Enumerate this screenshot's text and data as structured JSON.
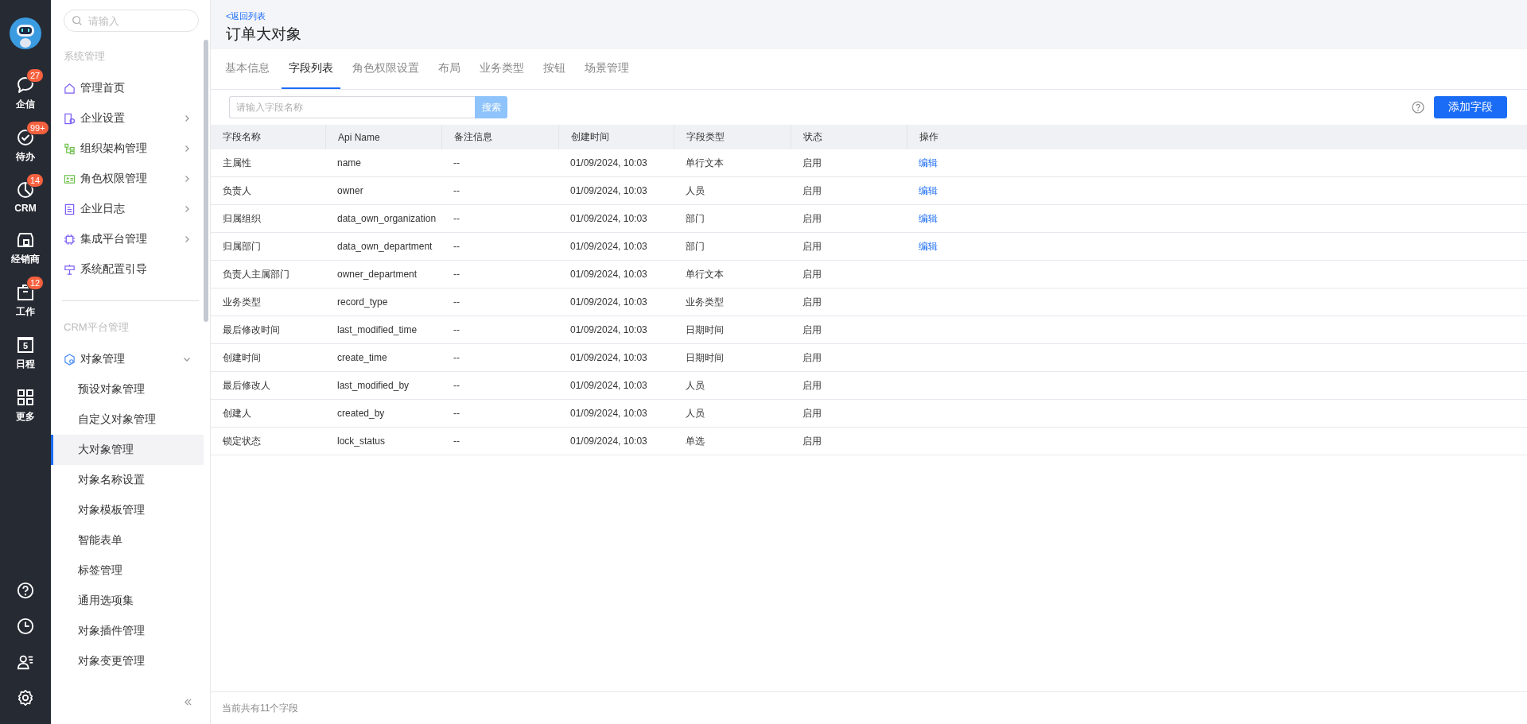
{
  "rail": {
    "items": [
      {
        "label": "企信",
        "badge": "27"
      },
      {
        "label": "待办",
        "badge": "99+"
      },
      {
        "label": "CRM",
        "badge": "14"
      },
      {
        "label": "经销商"
      },
      {
        "label": "工作",
        "badge": "12"
      },
      {
        "label": "日程",
        "day": "5"
      },
      {
        "label": "更多"
      }
    ]
  },
  "sidebar": {
    "search": {
      "placeholder": "请输入"
    },
    "sections": [
      {
        "title": "系统管理",
        "items": [
          {
            "label": "管理首页",
            "kind": "link"
          },
          {
            "label": "企业设置",
            "kind": "group",
            "expanded": false
          },
          {
            "label": "组织架构管理",
            "kind": "group",
            "expanded": false
          },
          {
            "label": "角色权限管理",
            "kind": "group",
            "expanded": false
          },
          {
            "label": "企业日志",
            "kind": "group",
            "expanded": false
          },
          {
            "label": "集成平台管理",
            "kind": "group",
            "expanded": false
          },
          {
            "label": "系统配置引导",
            "kind": "link"
          }
        ]
      },
      {
        "title": "CRM平台管理",
        "items": [
          {
            "label": "对象管理",
            "kind": "group",
            "expanded": true,
            "children": [
              {
                "label": "预设对象管理",
                "selected": false
              },
              {
                "label": "自定义对象管理",
                "selected": false
              },
              {
                "label": "大对象管理",
                "selected": true
              },
              {
                "label": "对象名称设置",
                "selected": false
              },
              {
                "label": "对象模板管理",
                "selected": false
              },
              {
                "label": "智能表单",
                "selected": false
              },
              {
                "label": "标签管理",
                "selected": false
              },
              {
                "label": "通用选项集",
                "selected": false
              },
              {
                "label": "对象插件管理",
                "selected": false
              },
              {
                "label": "对象变更管理",
                "selected": false
              }
            ]
          }
        ]
      }
    ]
  },
  "header": {
    "back_link": "<返回列表",
    "title": "订单大对象"
  },
  "tabs": [
    {
      "label": "基本信息",
      "selected": false
    },
    {
      "label": "字段列表",
      "selected": true
    },
    {
      "label": "角色权限设置",
      "selected": false
    },
    {
      "label": "布局",
      "selected": false
    },
    {
      "label": "业务类型",
      "selected": false
    },
    {
      "label": "按钮",
      "selected": false
    },
    {
      "label": "场景管理",
      "selected": false
    }
  ],
  "toolbar": {
    "search": {
      "placeholder": "请输入字段名称"
    },
    "search_button": "搜索",
    "add_button": "添加字段"
  },
  "table": {
    "columns": [
      "字段名称",
      "Api Name",
      "备注信息",
      "创建时间",
      "字段类型",
      "状态",
      "操作"
    ],
    "rows": [
      {
        "cells": [
          "主属性",
          "name",
          "--",
          "01/09/2024, 10:03",
          "单行文本",
          "启用"
        ],
        "action": "编辑"
      },
      {
        "cells": [
          "负责人",
          "owner",
          "--",
          "01/09/2024, 10:03",
          "人员",
          "启用"
        ],
        "action": "编辑"
      },
      {
        "cells": [
          "归属组织",
          "data_own_organization",
          "--",
          "01/09/2024, 10:03",
          "部门",
          "启用"
        ],
        "action": "编辑"
      },
      {
        "cells": [
          "归属部门",
          "data_own_department",
          "--",
          "01/09/2024, 10:03",
          "部门",
          "启用"
        ],
        "action": "编辑"
      },
      {
        "cells": [
          "负责人主属部门",
          "owner_department",
          "--",
          "01/09/2024, 10:03",
          "单行文本",
          "启用"
        ]
      },
      {
        "cells": [
          "业务类型",
          "record_type",
          "--",
          "01/09/2024, 10:03",
          "业务类型",
          "启用"
        ]
      },
      {
        "cells": [
          "最后修改时间",
          "last_modified_time",
          "--",
          "01/09/2024, 10:03",
          "日期时间",
          "启用"
        ]
      },
      {
        "cells": [
          "创建时间",
          "create_time",
          "--",
          "01/09/2024, 10:03",
          "日期时间",
          "启用"
        ]
      },
      {
        "cells": [
          "最后修改人",
          "last_modified_by",
          "--",
          "01/09/2024, 10:03",
          "人员",
          "启用"
        ]
      },
      {
        "cells": [
          "创建人",
          "created_by",
          "--",
          "01/09/2024, 10:03",
          "人员",
          "启用"
        ]
      },
      {
        "cells": [
          "锁定状态",
          "lock_status",
          "--",
          "01/09/2024, 10:03",
          "单选",
          "启用"
        ]
      }
    ]
  },
  "footer": "当前共有11个字段"
}
